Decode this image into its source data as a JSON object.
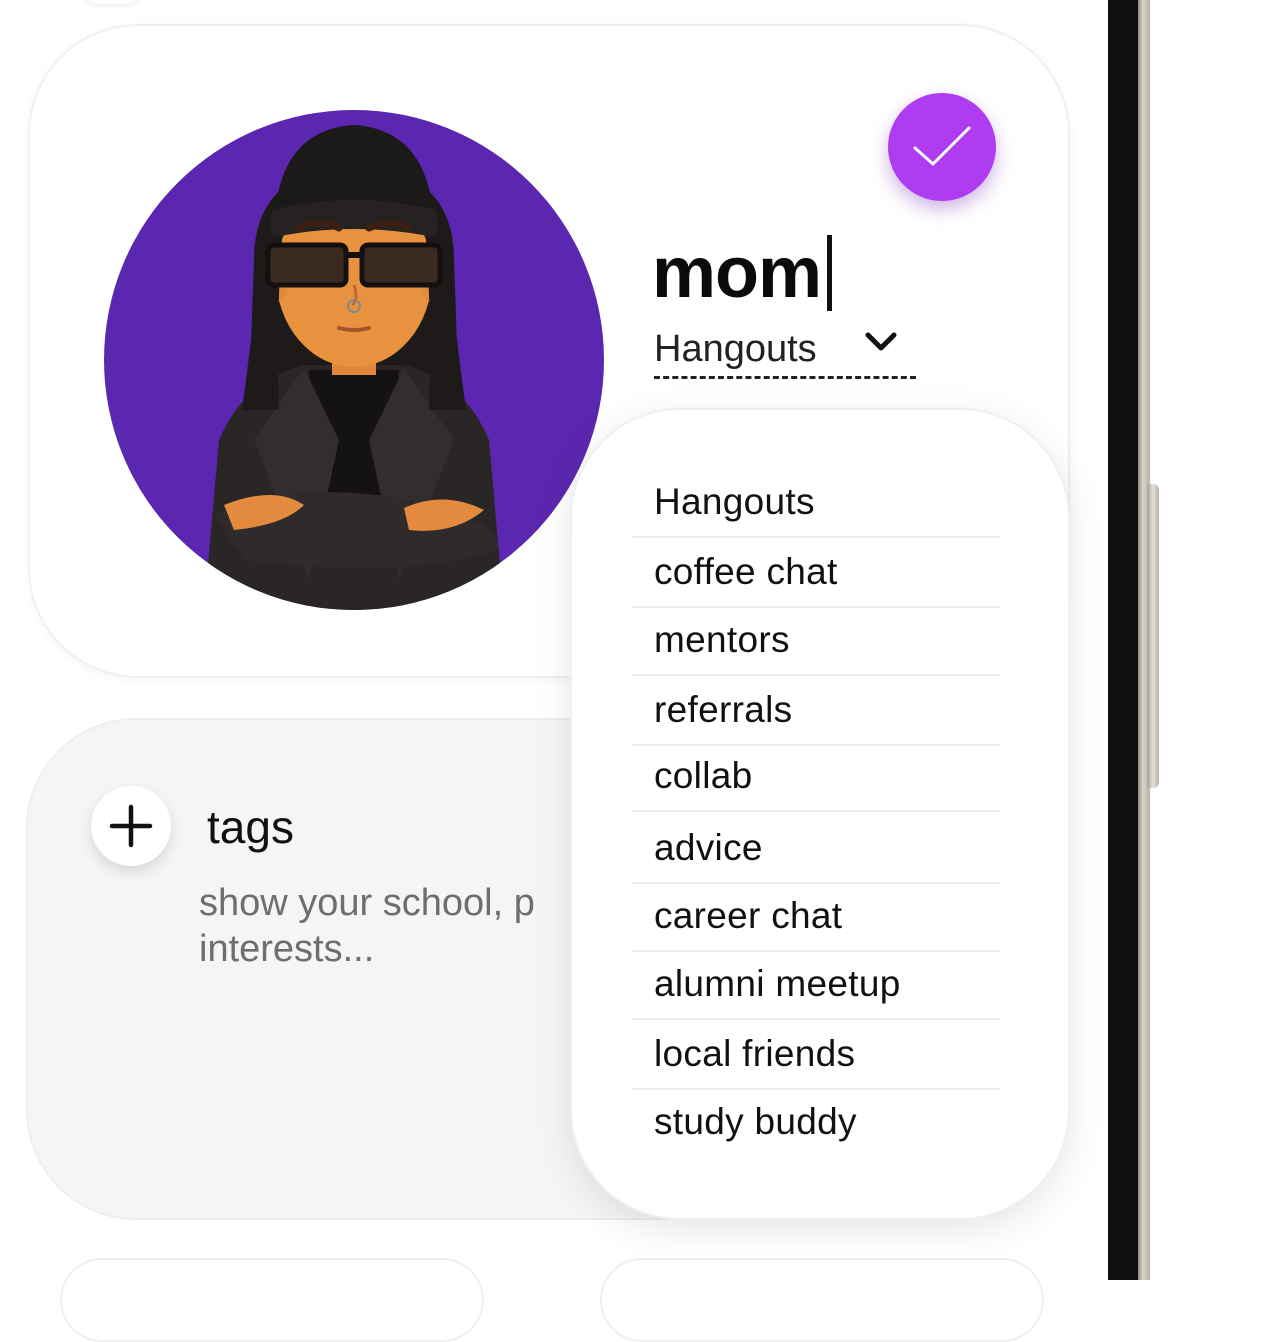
{
  "profile": {
    "name_value": "mom",
    "category_selected": "Hangouts"
  },
  "category_options": [
    "Hangouts",
    "coffee chat",
    "mentors",
    "referrals",
    "collab",
    "advice",
    "career chat",
    "alumni meetup",
    "local friends",
    "study buddy"
  ],
  "tags": {
    "title": "tags",
    "hint": "show your school, p\ninterests..."
  },
  "icons": {
    "confirm": "checkmark-icon",
    "select": "chevron-down-icon",
    "add": "plus-icon"
  },
  "colors": {
    "accent": "#b03cf2",
    "avatar_background": "#5b27b0"
  }
}
